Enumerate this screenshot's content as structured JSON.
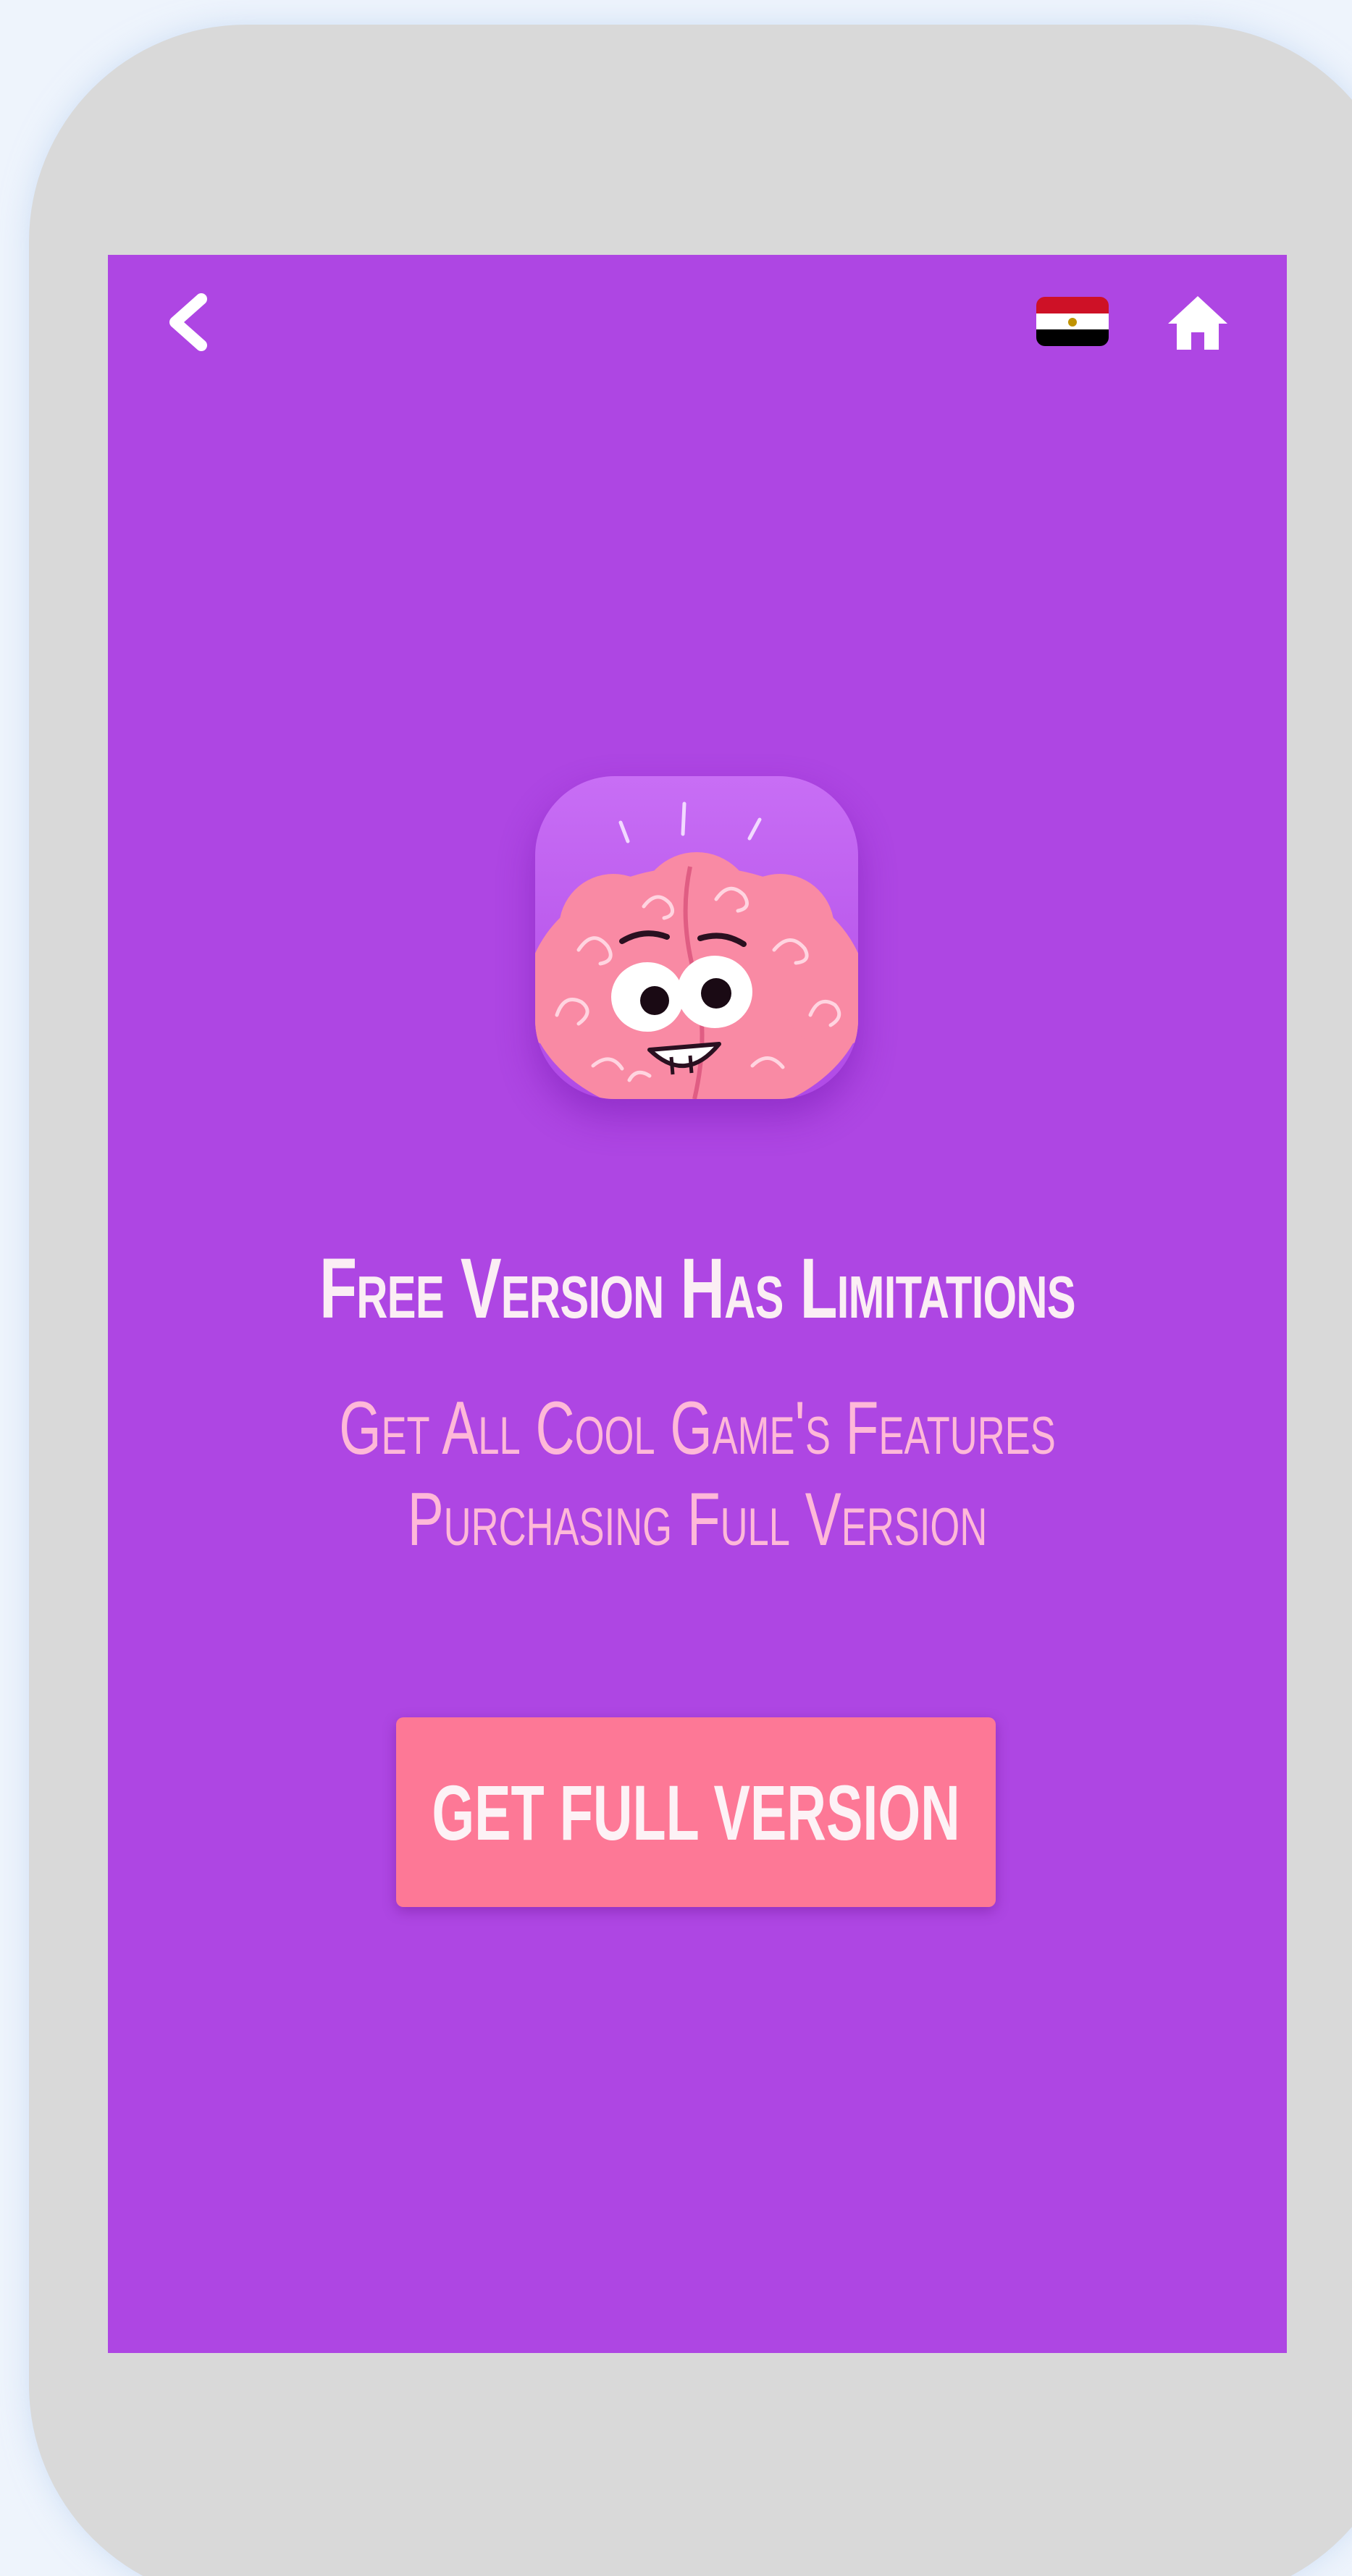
{
  "nav": {
    "back_icon": "chevron-left-icon",
    "language_icon": "egypt-flag-icon",
    "home_icon": "home-icon"
  },
  "promo": {
    "app_icon": "brain-mascot-icon",
    "headline": "Free Version Has Limitations",
    "subline_1": "Get All Cool Game's Features",
    "subline_2": "Purchasing Full Version",
    "cta_label": "GET FULL VERSION"
  },
  "colors": {
    "screen_background": "#ae46e3",
    "cta_background": "#fd7896",
    "headline_text": "#fbeef4",
    "subline_text": "#ffb8d8",
    "device_frame": "#d9d9d9"
  }
}
